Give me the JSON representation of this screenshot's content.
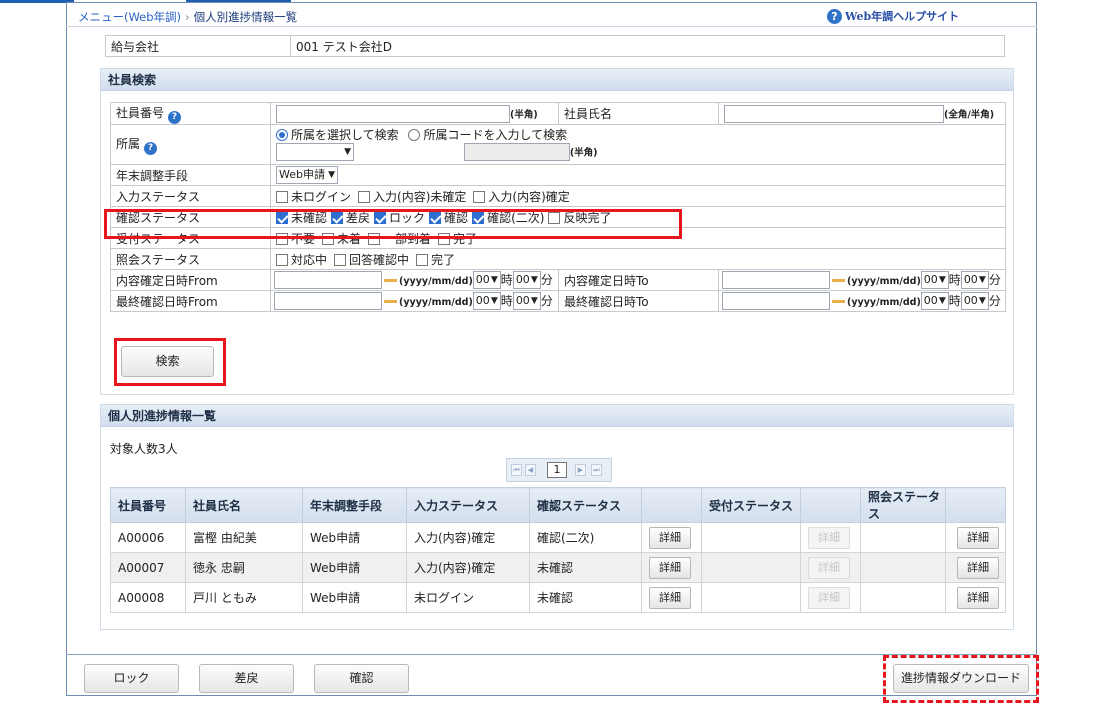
{
  "breadcrumb": {
    "menu": "メニュー(Web年調)",
    "sep": "›",
    "current": "個人別進捗情報一覧"
  },
  "help": {
    "icon": "?",
    "label": "Web年調ヘルプサイト"
  },
  "company": {
    "label": "給与会社",
    "value": "001 テスト会社D"
  },
  "search": {
    "title": "社員検索",
    "emp_no": {
      "label": "社員番号",
      "note": "(半角)"
    },
    "emp_name": {
      "label": "社員氏名",
      "note": "(全角/半角)"
    },
    "dept": {
      "label": "所属",
      "radio1": "所属を選択して検索",
      "radio2": "所属コードを入力して検索",
      "note": "(半角)"
    },
    "method": {
      "label": "年末調整手段",
      "value": "Web申請"
    },
    "input_status": {
      "label": "入力ステータス",
      "options": [
        {
          "text": "未ログイン",
          "checked": false
        },
        {
          "text": "入力(内容)未確定",
          "checked": false
        },
        {
          "text": "入力(内容)確定",
          "checked": false
        }
      ]
    },
    "confirm_status": {
      "label": "確認ステータス",
      "options": [
        {
          "text": "未確認",
          "checked": true
        },
        {
          "text": "差戻",
          "checked": true
        },
        {
          "text": "ロック",
          "checked": true
        },
        {
          "text": "確認",
          "checked": true
        },
        {
          "text": "確認(二次)",
          "checked": true
        },
        {
          "text": "反映完了",
          "checked": false
        }
      ]
    },
    "receipt_status": {
      "label": "受付ステータス",
      "options": [
        {
          "text": "不要",
          "checked": false
        },
        {
          "text": "未着",
          "checked": false
        },
        {
          "text": "一部到着",
          "checked": false
        },
        {
          "text": "完了",
          "checked": false
        }
      ]
    },
    "inquiry_status": {
      "label": "照会ステータス",
      "options": [
        {
          "text": "対応中",
          "checked": false
        },
        {
          "text": "回答確認中",
          "checked": false
        },
        {
          "text": "完了",
          "checked": false
        }
      ]
    },
    "content_from": {
      "label": "内容確定日時From"
    },
    "content_to": {
      "label": "内容確定日時To"
    },
    "last_from": {
      "label": "最終確認日時From"
    },
    "last_to": {
      "label": "最終確認日時To"
    },
    "date_fmt": "(yyyy/mm/dd)",
    "hour_val": "00",
    "hour_unit": "時",
    "min_val": "00",
    "min_unit": "分",
    "search_button": "検索"
  },
  "results": {
    "title": "個人別進捗情報一覧",
    "count": "対象人数3人",
    "page": "1",
    "headers": [
      "社員番号",
      "社員氏名",
      "年末調整手段",
      "入力ステータス",
      "確認ステータス",
      "",
      "受付ステータス",
      "",
      "照会ステータス",
      ""
    ],
    "detail": "詳細",
    "rows": [
      {
        "no": "A00006",
        "name": "富樫 由紀美",
        "method": "Web申請",
        "input": "入力(内容)確定",
        "confirm": "確認(二次)"
      },
      {
        "no": "A00007",
        "name": "徳永 忠嗣",
        "method": "Web申請",
        "input": "入力(内容)確定",
        "confirm": "未確認"
      },
      {
        "no": "A00008",
        "name": "戸川 ともみ",
        "method": "Web申請",
        "input": "未ログイン",
        "confirm": "未確認"
      }
    ]
  },
  "footer": {
    "lock": "ロック",
    "return": "差戻",
    "confirm": "確認",
    "download": "進捗情報ダウンロード"
  },
  "colors": {
    "highlight": "#e8151c",
    "accent": "#2f73c9"
  }
}
